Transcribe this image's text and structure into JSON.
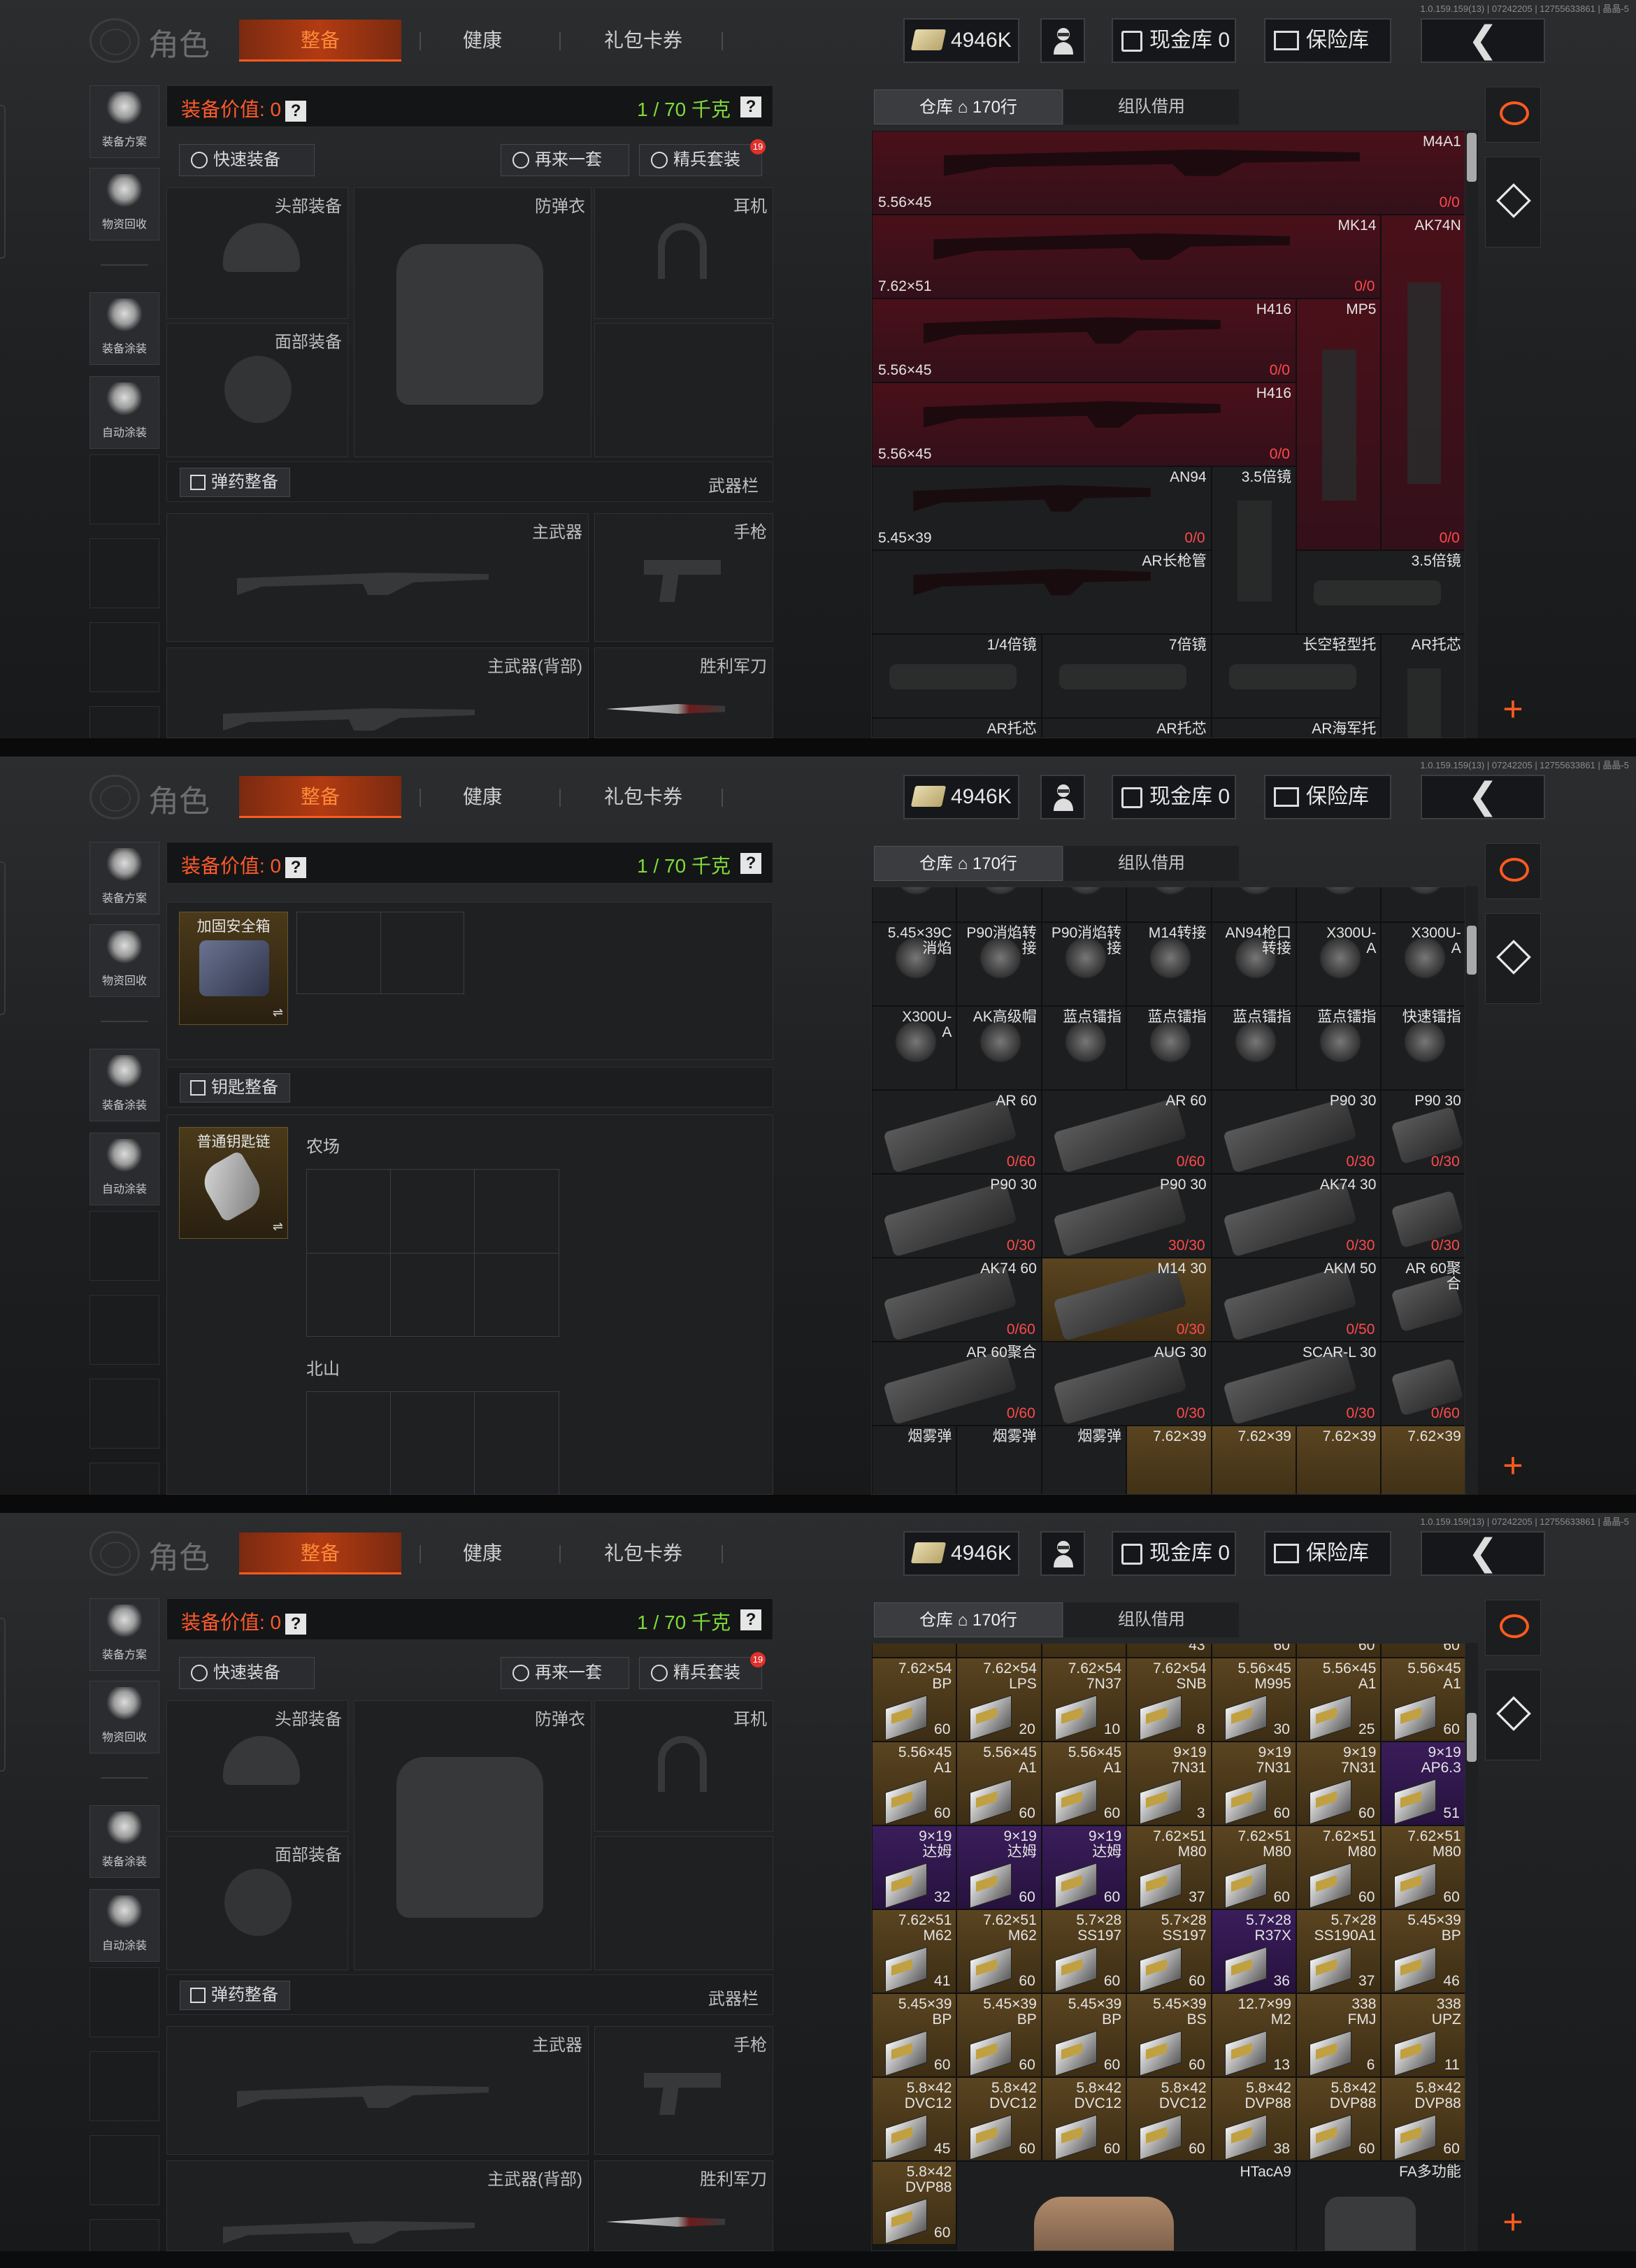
{
  "build": "1.0.159.159(13) | 07242205 | 12755633861 | 晶晶-5",
  "nav": {
    "title": "角色",
    "tabs": [
      "整备",
      "健康",
      "礼包卡券"
    ]
  },
  "top": {
    "cash": "4946K",
    "vault": "现金库 0",
    "safe": "保险库",
    "back": "❮"
  },
  "side": [
    "装备方案",
    "物资回收",
    "装备涂装",
    "自动涂装"
  ],
  "value": {
    "label": "装备价值: 0",
    "q": "?",
    "weight": "1 / 70 千克"
  },
  "buttons": {
    "quick": "快速装备",
    "again": "再来一套",
    "elite": "精兵套装",
    "elite_badge": "19"
  },
  "slots": {
    "head": "头部装备",
    "armor": "防弹衣",
    "ear": "耳机",
    "face": "面部装备",
    "primary": "主武器",
    "pistol": "手枪",
    "back": "主武器(背部)",
    "knife": "胜利军刀"
  },
  "ammo": {
    "btn": "弹药整备",
    "right": "武器栏"
  },
  "key": {
    "btn": "钥匙整备",
    "container": "加固安全箱",
    "keychain": "普通钥匙链",
    "farm": "农场",
    "north": "北山",
    "swap": "⇌"
  },
  "right": {
    "tab_warehouse": "仓库 ⌂ 170行",
    "tab_team": "组队借用",
    "plus": "+"
  },
  "grid1": [
    {
      "n": "M4A1",
      "cal": "5.56×45",
      "ct": "0/0"
    },
    {
      "n": "MK14",
      "cal": "7.62×51",
      "ct": "0/0"
    },
    {
      "n": "AK74N",
      "ct": "0/0"
    },
    {
      "n": "H416",
      "cal": "5.56×45",
      "ct": "0/0"
    },
    {
      "n": "MP5"
    },
    {
      "n": "H416",
      "cal": "5.56×45",
      "ct": "0/0"
    },
    {
      "n": "AN94",
      "cal": "5.45×39",
      "ct": "0/0"
    },
    {
      "n": "3.5倍镜"
    },
    {
      "n": "AR长枪管"
    },
    {
      "n": "3.5倍镜"
    },
    {
      "n": "1/4倍镜"
    },
    {
      "n": "7倍镜"
    },
    {
      "n": "长空轻型托"
    },
    {
      "n": "AR托芯"
    },
    {
      "n": "AR托芯"
    },
    {
      "n": "AR托芯"
    },
    {
      "n": "AR海军托"
    }
  ],
  "grid2": {
    "row0": [
      "",
      "",
      "",
      "",
      "",
      "",
      ""
    ],
    "rows": [
      [
        {
          "n": "5.45×39C\n消焰"
        },
        {
          "n": "P90消焰转\n接"
        },
        {
          "n": "P90消焰转\n接"
        },
        {
          "n": "M14转接"
        },
        {
          "n": "AN94枪口\n转接"
        },
        {
          "n": "X300U-\nA"
        },
        {
          "n": "X300U-\nA"
        }
      ],
      [
        {
          "n": "X300U-\nA"
        },
        {
          "n": "AK高级帽"
        },
        {
          "n": "蓝点镭指"
        },
        {
          "n": "蓝点镭指"
        },
        {
          "n": "蓝点镭指"
        },
        {
          "n": "蓝点镭指"
        },
        {
          "n": "快速镭指"
        }
      ],
      [
        {
          "n": "AR 60",
          "ct": "0/60",
          "w": 2
        },
        {
          "n": "AR 60",
          "ct": "0/60",
          "w": 2
        },
        {
          "n": "P90 30",
          "ct": "0/30",
          "w": 2
        },
        {
          "n": "P90 30",
          "ct": "0/30",
          "w": 1
        }
      ],
      [
        {
          "n": "P90 30",
          "ct": "0/30",
          "w": 2
        },
        {
          "n": "P90 30",
          "ct": "30/30",
          "w": 2
        },
        {
          "n": "AK74 30",
          "ct": "0/30",
          "w": 2
        },
        {
          "n": "",
          "ct": "0/30",
          "w": 1
        }
      ],
      [
        {
          "n": "AK74 60",
          "ct": "0/60",
          "w": 2
        },
        {
          "n": "M14 30",
          "ct": "0/30",
          "w": 2
        },
        {
          "n": "AKM 50",
          "ct": "0/50",
          "w": 2
        },
        {
          "n": "AR 60聚\n合",
          "w": 1
        }
      ],
      [
        {
          "n": "AR 60聚合",
          "ct": "0/60",
          "w": 2
        },
        {
          "n": "AUG 30",
          "ct": "0/30",
          "w": 2
        },
        {
          "n": "SCAR-L 30",
          "ct": "0/30",
          "w": 2
        },
        {
          "n": "",
          "ct": "0/60",
          "w": 1
        }
      ]
    ],
    "last": [
      "烟雾弹",
      "烟雾弹",
      "烟雾弹",
      "7.62×39",
      "7.62×39",
      "7.62×39",
      "7.62×39"
    ]
  },
  "grid3": [
    [
      {
        "c": "7.62×54\nBP",
        "q": "60"
      },
      {
        "c": "7.62×54\nLPS",
        "q": "20"
      },
      {
        "c": "7.62×54\n7N37",
        "q": "10"
      },
      {
        "c": "7.62×54\nSNB",
        "q": "8"
      },
      {
        "c": "5.56×45\nM995",
        "q": "30"
      },
      {
        "c": "5.56×45\nA1",
        "q": "25"
      },
      {
        "c": "5.56×45\nA1",
        "q": "60"
      }
    ],
    [
      {
        "c": "5.56×45\nA1",
        "q": "60"
      },
      {
        "c": "5.56×45\nA1",
        "q": "60"
      },
      {
        "c": "5.56×45\nA1",
        "q": "60"
      },
      {
        "c": "9×19\n7N31",
        "q": "3"
      },
      {
        "c": "9×19\n7N31",
        "q": "60"
      },
      {
        "c": "9×19\n7N31",
        "q": "60"
      },
      {
        "c": "9×19\nAP6.3",
        "q": "51"
      }
    ],
    [
      {
        "c": "9×19\n达姆",
        "q": "32"
      },
      {
        "c": "9×19\n达姆",
        "q": "60"
      },
      {
        "c": "9×19\n达姆",
        "q": "60"
      },
      {
        "c": "7.62×51\nM80",
        "q": "37"
      },
      {
        "c": "7.62×51\nM80",
        "q": "60"
      },
      {
        "c": "7.62×51\nM80",
        "q": "60"
      },
      {
        "c": "7.62×51\nM80",
        "q": "60"
      }
    ],
    [
      {
        "c": "7.62×51\nM62",
        "q": "41"
      },
      {
        "c": "7.62×51\nM62",
        "q": "60"
      },
      {
        "c": "5.7×28\nSS197",
        "q": "60"
      },
      {
        "c": "5.7×28\nSS197",
        "q": "60"
      },
      {
        "c": "5.7×28\nR37X",
        "q": "36"
      },
      {
        "c": "5.7×28\nSS190A1",
        "q": "37"
      },
      {
        "c": "5.45×39\nBP",
        "q": "46"
      }
    ],
    [
      {
        "c": "5.45×39\nBP",
        "q": "60"
      },
      {
        "c": "5.45×39\nBP",
        "q": "60"
      },
      {
        "c": "5.45×39\nBP",
        "q": "60"
      },
      {
        "c": "5.45×39\nBS",
        "q": "60"
      },
      {
        "c": "12.7×99\nM2",
        "q": "13"
      },
      {
        "c": "338\nFMJ",
        "q": "6"
      },
      {
        "c": "338\nUPZ",
        "q": "11"
      }
    ],
    [
      {
        "c": "5.8×42\nDVC12",
        "q": "45"
      },
      {
        "c": "5.8×42\nDVC12",
        "q": "60"
      },
      {
        "c": "5.8×42\nDVC12",
        "q": "60"
      },
      {
        "c": "5.8×42\nDVC12",
        "q": "60"
      },
      {
        "c": "5.8×42\nDVP88",
        "q": "38"
      },
      {
        "c": "5.8×42\nDVP88",
        "q": "60"
      },
      {
        "c": "5.8×42\nDVP88",
        "q": "60"
      }
    ]
  ],
  "grid3_top": [
    "43",
    "60",
    "60",
    "60"
  ],
  "grid3_last": {
    "a": "5.8×42\nDVP88",
    "aq": "60",
    "b": "HTacA9",
    "c": "FA多功能"
  }
}
